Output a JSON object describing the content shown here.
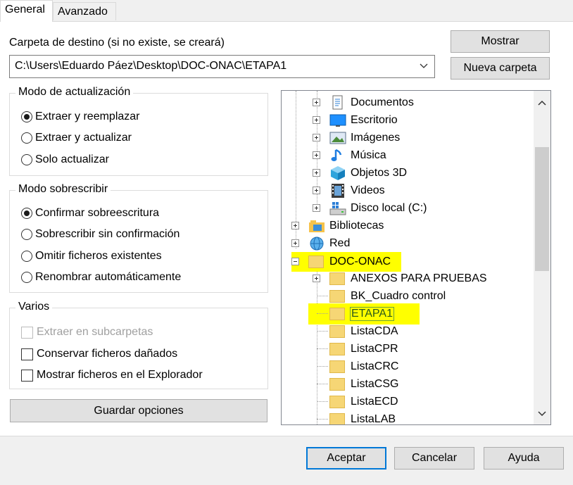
{
  "tabs": [
    "General",
    "Avanzado"
  ],
  "destination": {
    "label": "Carpeta de destino (si no existe, se creará)",
    "value": "C:\\Users\\Eduardo Páez\\Desktop\\DOC-ONAC\\ETAPA1"
  },
  "buttons": {
    "show": "Mostrar",
    "new_folder": "Nueva carpeta",
    "save_options": "Guardar opciones",
    "accept": "Aceptar",
    "cancel": "Cancelar",
    "help": "Ayuda"
  },
  "update_mode": {
    "title": "Modo de actualización",
    "options": [
      "Extraer y reemplazar",
      "Extraer y actualizar",
      "Solo actualizar"
    ],
    "selected": 0
  },
  "overwrite_mode": {
    "title": "Modo sobrescribir",
    "options": [
      "Confirmar sobreescritura",
      "Sobrescribir sin confirmación",
      "Omitir ficheros existentes",
      "Renombrar automáticamente"
    ],
    "selected": 0
  },
  "misc": {
    "title": "Varios",
    "options": [
      "Extraer en subcarpetas",
      "Conservar ficheros dañados",
      "Mostrar ficheros en el Explorador"
    ]
  },
  "tree": {
    "items": [
      {
        "label": "Documentos",
        "icon": "documents-icon",
        "expander": "plus"
      },
      {
        "label": "Escritorio",
        "icon": "desktop-icon",
        "expander": "plus"
      },
      {
        "label": "Imágenes",
        "icon": "pictures-icon",
        "expander": "plus"
      },
      {
        "label": "Música",
        "icon": "music-icon",
        "expander": "plus"
      },
      {
        "label": "Objetos 3D",
        "icon": "3d-objects-icon",
        "expander": "plus"
      },
      {
        "label": "Videos",
        "icon": "videos-icon",
        "expander": "plus"
      },
      {
        "label": "Disco local (C:)",
        "icon": "local-disk-icon",
        "expander": "plus"
      },
      {
        "label": "Bibliotecas",
        "icon": "libraries-icon",
        "expander": "plus"
      },
      {
        "label": "Red",
        "icon": "network-icon",
        "expander": "plus"
      },
      {
        "label": "DOC-ONAC",
        "icon": "folder-icon",
        "expander": "minus"
      },
      {
        "label": "ANEXOS PARA PRUEBAS",
        "icon": "folder-icon",
        "expander": "plus"
      },
      {
        "label": "BK_Cuadro control",
        "icon": "folder-icon",
        "expander": "none"
      },
      {
        "label": "ETAPA1",
        "icon": "folder-icon",
        "expander": "none"
      },
      {
        "label": "ListaCDA",
        "icon": "folder-icon",
        "expander": "none"
      },
      {
        "label": "ListaCPR",
        "icon": "folder-icon",
        "expander": "none"
      },
      {
        "label": "ListaCRC",
        "icon": "folder-icon",
        "expander": "none"
      },
      {
        "label": "ListaCSG",
        "icon": "folder-icon",
        "expander": "none"
      },
      {
        "label": "ListaECD",
        "icon": "folder-icon",
        "expander": "none"
      },
      {
        "label": "ListaLAB",
        "icon": "folder-icon",
        "expander": "none"
      }
    ]
  },
  "colors": {
    "highlight": "#ffff00",
    "accent": "#0078d7"
  }
}
